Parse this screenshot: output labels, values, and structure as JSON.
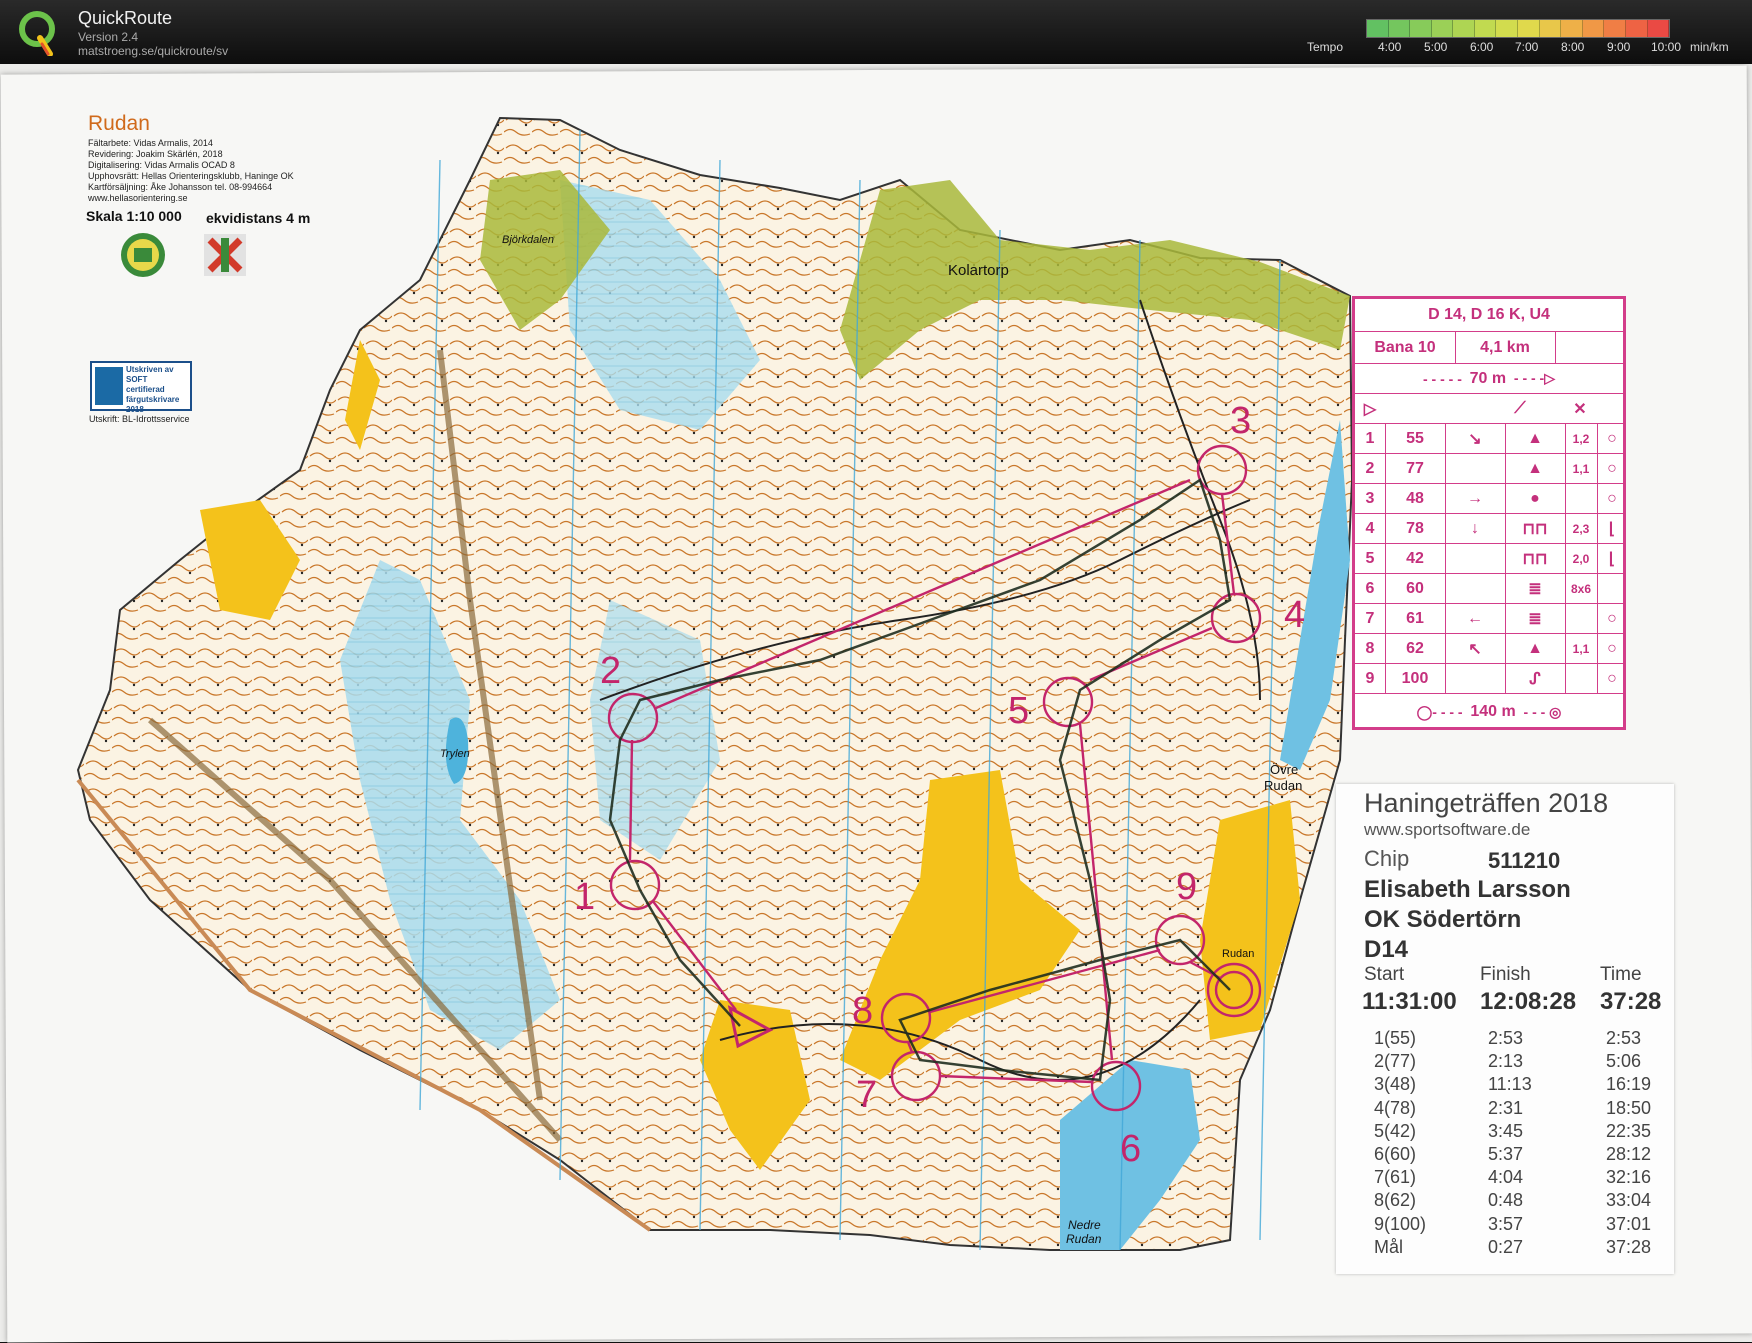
{
  "app": {
    "title": "QuickRoute",
    "version": "Version 2.4",
    "url": "matstroeng.se/quickroute/sv"
  },
  "tempo": {
    "label": "Tempo",
    "ticks": [
      "4:00",
      "5:00",
      "6:00",
      "7:00",
      "8:00",
      "9:00",
      "10:00"
    ],
    "unit": "min/km",
    "colors": [
      "#62c162",
      "#74c65e",
      "#87cb5a",
      "#9bd057",
      "#aed553",
      "#c1da50",
      "#d2dc4e",
      "#e0d94c",
      "#e8c74a",
      "#eeb048",
      "#f09846",
      "#f07e45",
      "#ee6344",
      "#ea4a44"
    ]
  },
  "map": {
    "name": "Rudan",
    "credits": [
      "Fältarbete: Vidas Armalis, 2014",
      "Revidering: Joakim Skärlén, 2018",
      "Digitalisering: Vidas Armalis OCAD 8",
      "Upphovsrätt: Hellas Orienteringsklubb, Haninge OK",
      "Kartförsäljning: Åke Johansson tel. 08-994664",
      "www.hellasorientering.se"
    ],
    "scale": "Skala 1:10 000",
    "equidistance": "ekvidistans 4 m",
    "soft_text": [
      "Utskriven av",
      "SOFT certifierad",
      "färgutskrivare",
      "2018"
    ],
    "printer": "Utskrift: BL-Idrottsservice",
    "places": {
      "bjorkdalen": "Björkdalen",
      "kolartorp": "Kolartorp",
      "trylen": "Trylen",
      "ovre_rudan_1": "Övre",
      "ovre_rudan_2": "Rudan",
      "rudan": "Rudan",
      "nedre_1": "Nedre",
      "nedre_2": "Rudan"
    },
    "control_numbers": [
      "1",
      "2",
      "3",
      "4",
      "5",
      "6",
      "7",
      "8",
      "9"
    ],
    "colors": {
      "course": "#c3256b",
      "water": "#8fd2ea",
      "open": "#f4c21b",
      "green": "#a9b93b",
      "contour": "#c9772a"
    }
  },
  "control_description": {
    "title": "D 14, D 16 K, U4",
    "course": "Bana 10",
    "length": "4,1 km",
    "start_dist": "70 m",
    "finish_dist": "140 m",
    "controls": [
      {
        "n": "1",
        "code": "55",
        "dir": "↘",
        "feat": "▲",
        "dim": "1,2",
        "extra": "○"
      },
      {
        "n": "2",
        "code": "77",
        "dir": "",
        "feat": "▲",
        "dim": "1,1",
        "extra": "○"
      },
      {
        "n": "3",
        "code": "48",
        "dir": "→",
        "feat": "●",
        "dim": "",
        "extra": "○"
      },
      {
        "n": "4",
        "code": "78",
        "dir": "↓",
        "feat": "⊓⊓",
        "dim": "2,3",
        "extra": "⌊"
      },
      {
        "n": "5",
        "code": "42",
        "dir": "",
        "feat": "⊓⊓",
        "dim": "2,0",
        "extra": "⌊"
      },
      {
        "n": "6",
        "code": "60",
        "dir": "",
        "feat": "≣",
        "dim": "8x6",
        "extra": ""
      },
      {
        "n": "7",
        "code": "61",
        "dir": "←",
        "feat": "≣",
        "dim": "",
        "extra": "○"
      },
      {
        "n": "8",
        "code": "62",
        "dir": "↖",
        "feat": "▲",
        "dim": "1,1",
        "extra": "○"
      },
      {
        "n": "9",
        "code": "100",
        "dir": "",
        "feat": "ᔑ",
        "dim": "",
        "extra": "○"
      }
    ]
  },
  "ticket": {
    "title": "Haningeträffen 2018",
    "site": "www.sportsoftware.de",
    "chip_label": "Chip",
    "chip": "511210",
    "name": "Elisabeth Larsson",
    "club": "OK Södertörn",
    "class": "D14",
    "start_label": "Start",
    "finish_label": "Finish",
    "time_label": "Time",
    "start": "11:31:00",
    "finish": "12:08:28",
    "time": "37:28",
    "splits": [
      {
        "ctrl": "1(55)",
        "split": "2:53",
        "total": "2:53"
      },
      {
        "ctrl": "2(77)",
        "split": "2:13",
        "total": "5:06"
      },
      {
        "ctrl": "3(48)",
        "split": "11:13",
        "total": "16:19"
      },
      {
        "ctrl": "4(78)",
        "split": "2:31",
        "total": "18:50"
      },
      {
        "ctrl": "5(42)",
        "split": "3:45",
        "total": "22:35"
      },
      {
        "ctrl": "6(60)",
        "split": "5:37",
        "total": "28:12"
      },
      {
        "ctrl": "7(61)",
        "split": "4:04",
        "total": "32:16"
      },
      {
        "ctrl": "8(62)",
        "split": "0:48",
        "total": "33:04"
      },
      {
        "ctrl": "9(100)",
        "split": "3:57",
        "total": "37:01"
      },
      {
        "ctrl": "Mål",
        "split": "0:27",
        "total": "37:28"
      }
    ]
  }
}
